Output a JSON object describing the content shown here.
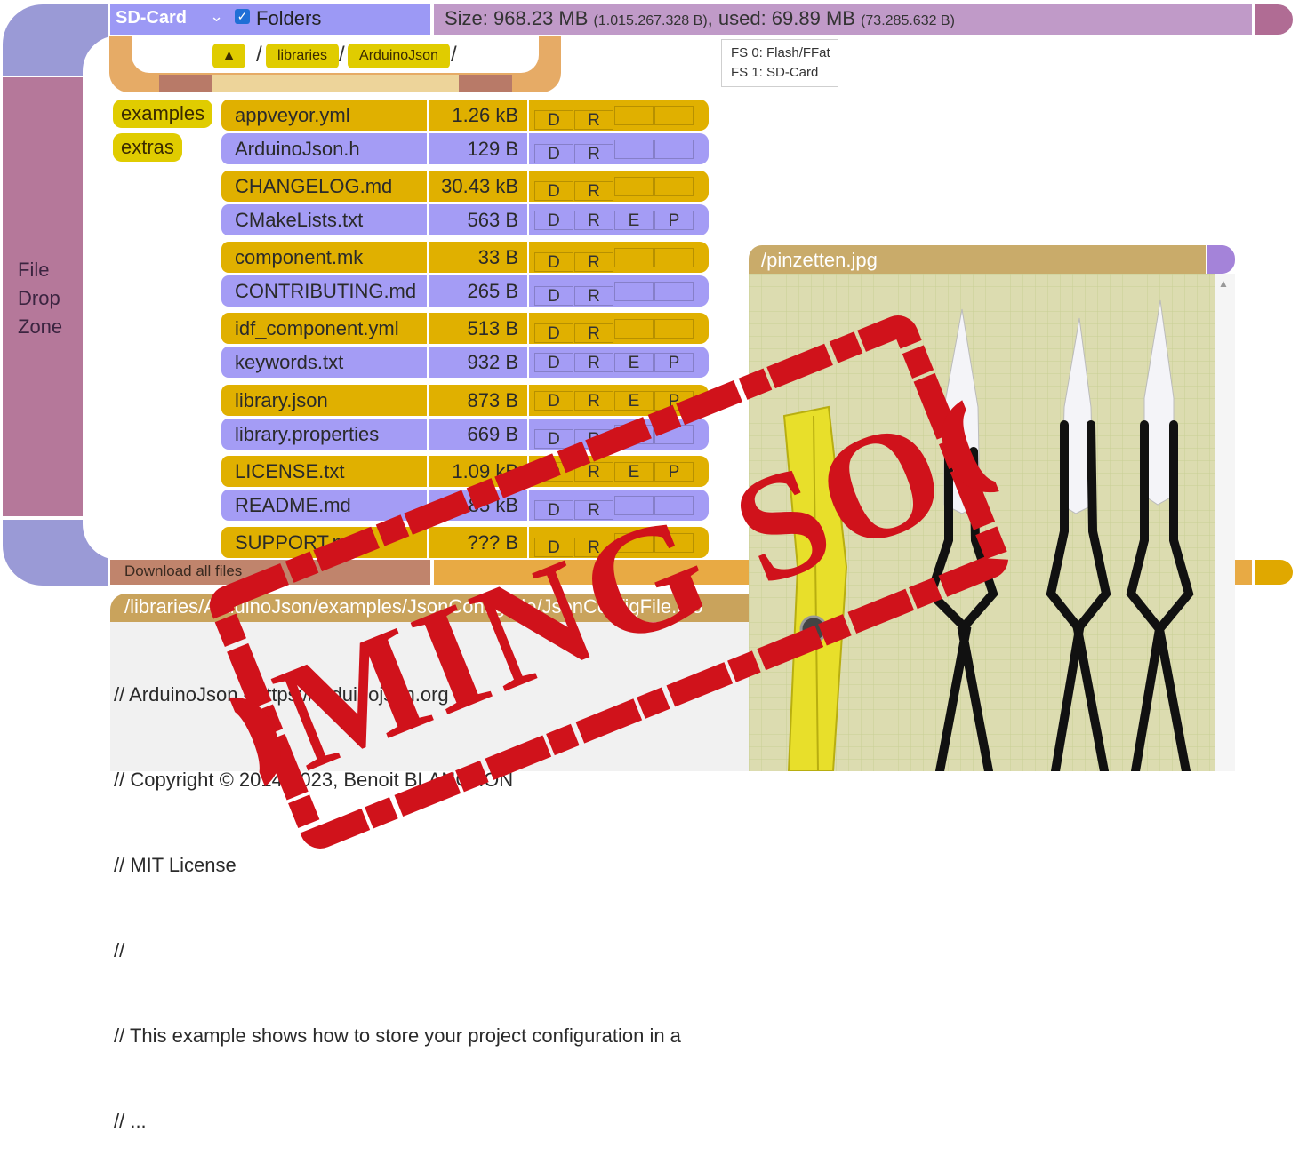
{
  "sidebar": {
    "drop_zone_lines": [
      "File",
      "Drop",
      "Zone"
    ]
  },
  "header": {
    "drive": "SD-Card",
    "folders_label": "Folders",
    "folders_checked": true,
    "size_main": "Size: 968.23 MB ",
    "size_bytes": "(1.015.267.328 B)",
    "used_main": ", used: 69.89 MB ",
    "used_bytes": "(73.285.632 B)"
  },
  "fs_menu": [
    "FS 0: Flash/FFat",
    "FS 1: SD-Card"
  ],
  "breadcrumb": {
    "up": "▲",
    "parts": [
      "libraries",
      "ArduinoJson"
    ]
  },
  "folders": [
    "examples",
    "extras"
  ],
  "files": [
    {
      "name": "appveyor.yml",
      "size": "1.26 kB",
      "actions": [
        "D",
        "R"
      ]
    },
    {
      "name": "ArduinoJson.h",
      "size": "129 B",
      "actions": [
        "D",
        "R"
      ]
    },
    {
      "name": "CHANGELOG.md",
      "size": "30.43 kB",
      "actions": [
        "D",
        "R"
      ]
    },
    {
      "name": "CMakeLists.txt",
      "size": "563 B",
      "actions": [
        "D",
        "R",
        "E",
        "P"
      ]
    },
    {
      "name": "component.mk",
      "size": "33 B",
      "actions": [
        "D",
        "R"
      ]
    },
    {
      "name": "CONTRIBUTING.md",
      "size": "265 B",
      "actions": [
        "D",
        "R"
      ]
    },
    {
      "name": "idf_component.yml",
      "size": "513 B",
      "actions": [
        "D",
        "R"
      ]
    },
    {
      "name": "keywords.txt",
      "size": "932 B",
      "actions": [
        "D",
        "R",
        "E",
        "P"
      ]
    },
    {
      "name": "library.json",
      "size": "873 B",
      "actions": [
        "D",
        "R",
        "E",
        "P"
      ]
    },
    {
      "name": "library.properties",
      "size": "669 B",
      "actions": [
        "D",
        "R"
      ]
    },
    {
      "name": "LICENSE.txt",
      "size": "1.09 kB",
      "actions": [
        "D",
        "R",
        "E",
        "P"
      ]
    },
    {
      "name": "README.md",
      "size": "10.85 kB",
      "actions": [
        "D",
        "R"
      ]
    },
    {
      "name": "SUPPORT.md",
      "size": "??? B",
      "actions": [
        "D",
        "R"
      ]
    }
  ],
  "download_all": "Download all files",
  "editor": {
    "path": "/libraries/ArduinoJson/examples/JsonConfigFile/JsonConfigFile.ino",
    "lines": [
      "// ArduinoJson - https://arduinojson.org",
      "// Copyright © 2014-2023, Benoit BLANCHON",
      "// MIT License",
      "//",
      "// This example shows how to store your project configuration in a",
      "// ..."
    ]
  },
  "viewer": {
    "title": "/pinzetten.jpg"
  },
  "stamp": {
    "text": "COMING SOON"
  },
  "colors": {
    "row_yellow": "#e0b000",
    "row_purple": "#a49cf5",
    "button_yellow": "#e0cc00",
    "frame_purple": "#9a9ad6",
    "frame_mauve": "#b5789a",
    "stamp_red": "#d0121b"
  }
}
